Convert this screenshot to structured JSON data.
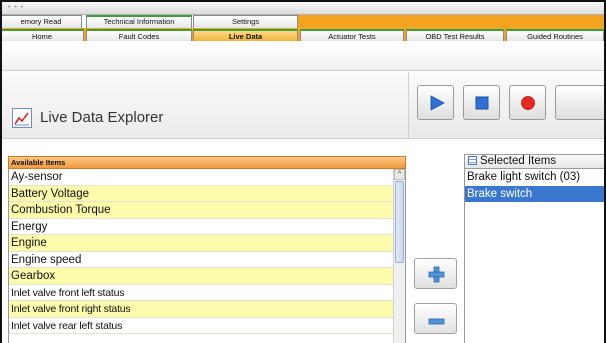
{
  "window": {
    "title_dots": "• • •"
  },
  "top_tabs": [
    {
      "label": "emory Read"
    },
    {
      "label": "Technical Information"
    },
    {
      "label": "Settings"
    }
  ],
  "nav_tabs": [
    {
      "label": "Home"
    },
    {
      "label": "Fault Codes"
    },
    {
      "label": "Live Data",
      "active": true
    },
    {
      "label": "Actuator Tests"
    },
    {
      "label": "OBD Test Results"
    },
    {
      "label": "Guided Routines"
    }
  ],
  "header": {
    "title": "Live Data Explorer",
    "icon": "line-chart-icon"
  },
  "controls": [
    {
      "name": "play",
      "icon": "play-icon"
    },
    {
      "name": "stop",
      "icon": "stop-icon"
    },
    {
      "name": "record",
      "icon": "record-icon"
    }
  ],
  "available": {
    "header": "Available Items",
    "items": [
      {
        "label": "Ay-sensor",
        "highlight": false
      },
      {
        "label": "Battery Voltage",
        "highlight": true
      },
      {
        "label": "Combustion Torque",
        "highlight": true
      },
      {
        "label": "Energy",
        "highlight": false
      },
      {
        "label": "Engine",
        "highlight": true
      },
      {
        "label": "Engine speed",
        "highlight": false
      },
      {
        "label": "Gearbox",
        "highlight": true
      },
      {
        "label": "Inlet valve front left status",
        "highlight": false
      },
      {
        "label": "Inlet valve front right status",
        "highlight": true
      },
      {
        "label": "Inlet valve rear left status",
        "highlight": false
      }
    ]
  },
  "move_buttons": {
    "add_icon": "plus-icon",
    "remove_icon": "minus-icon"
  },
  "selected": {
    "header": "Selected Items",
    "items": [
      {
        "label": "Brake light switch (03)",
        "selected": false
      },
      {
        "label": "Brake switch",
        "selected": true
      }
    ]
  },
  "colors": {
    "accent_orange": "#f3a31f",
    "tab_green": "#3aa03a",
    "selection_blue": "#3a77cf",
    "row_yellow": "#fbfbab"
  }
}
